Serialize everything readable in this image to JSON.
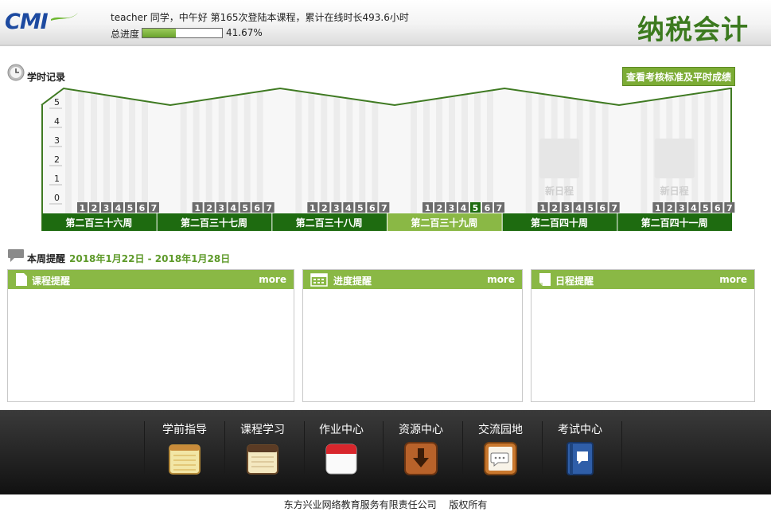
{
  "header": {
    "logo_text": "CMI",
    "greeting": "teacher 同学，中午好 第165次登陆本课程，累计在线时长493.6小时",
    "progress_label": "总进度",
    "progress_value": 0.4167,
    "progress_text": "41.67%",
    "course_title": "纳税会计"
  },
  "study_record": {
    "title": "学时记录",
    "view_button": "查看考核标准及平时成绩",
    "y_ticks": [
      "5",
      "4",
      "3",
      "2",
      "1",
      "0"
    ],
    "day_numbers": [
      "1",
      "2",
      "3",
      "4",
      "5",
      "6",
      "7"
    ],
    "weeks": [
      {
        "label": "第二百三十六周",
        "active": false,
        "future": false
      },
      {
        "label": "第二百三十七周",
        "active": false,
        "future": false
      },
      {
        "label": "第二百三十八周",
        "active": false,
        "future": false
      },
      {
        "label": "第二百三十九周",
        "active": true,
        "future": false,
        "highlight_day": 5
      },
      {
        "label": "第二百四十周",
        "active": false,
        "future": true
      },
      {
        "label": "第二百四十一周",
        "active": false,
        "future": true
      }
    ],
    "new_schedule_label": "新日程",
    "colors": {
      "week_bar": "#1e6b10",
      "week_active": "#8ab845",
      "line": "#3f7a22",
      "day_box": "#6b6b6b",
      "day_highlight": "#1e6b10"
    }
  },
  "weekly": {
    "title": "本周提醒",
    "date_range": "2018年1月22日 - 2018年1月28日",
    "panels": [
      {
        "title": "课程提醒",
        "more": "more",
        "icon": "page-icon"
      },
      {
        "title": "进度提醒",
        "more": "more",
        "icon": "calendar-icon"
      },
      {
        "title": "日程提醒",
        "more": "more",
        "icon": "note-icon"
      }
    ]
  },
  "footer_nav": [
    {
      "label": "学前指导",
      "icon": "notepad-icon"
    },
    {
      "label": "课程学习",
      "icon": "notebook-icon"
    },
    {
      "label": "作业中心",
      "icon": "calendar-red-icon"
    },
    {
      "label": "资源中心",
      "icon": "download-icon"
    },
    {
      "label": "交流园地",
      "icon": "chat-icon"
    },
    {
      "label": "考试中心",
      "icon": "book-icon"
    }
  ],
  "copyright": "东方兴业网络教育服务有限责任公司　 版权所有"
}
